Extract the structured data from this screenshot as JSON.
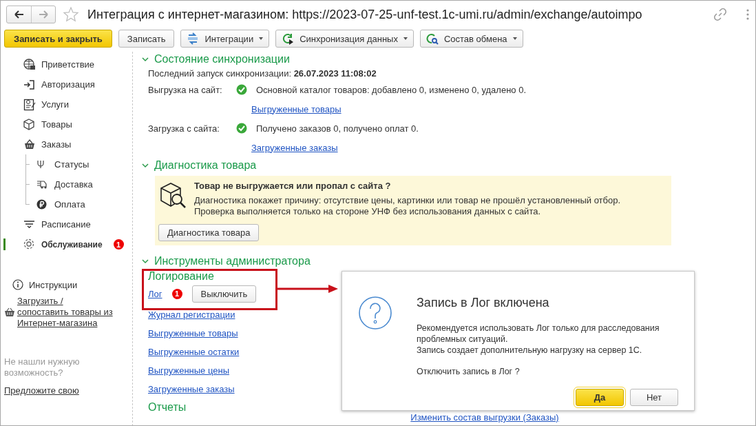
{
  "window": {
    "title": "Интеграция с интернет-магазином: https://2023-07-25-unf-test.1c-umi.ru/admin/exchange/autoimpo"
  },
  "toolbar": [
    {
      "label": "Записать и закрыть",
      "kind": "primary"
    },
    {
      "label": "Записать",
      "kind": "plain"
    },
    {
      "label": "Интеграции",
      "kind": "menu"
    },
    {
      "label": "Синхронизация данных",
      "kind": "menu"
    },
    {
      "label": "Состав обмена",
      "kind": "menu"
    }
  ],
  "sidebar": {
    "items": [
      {
        "label": "Приветствие",
        "selected": false
      },
      {
        "label": "Авторизация",
        "selected": false
      },
      {
        "label": "Услуги",
        "selected": false
      },
      {
        "label": "Товары",
        "selected": false
      },
      {
        "label": "Заказы",
        "selected": false,
        "children": [
          {
            "label": "Статусы",
            "selected": false
          },
          {
            "label": "Доставка",
            "selected": false
          },
          {
            "label": "Оплата",
            "selected": false
          }
        ]
      },
      {
        "label": "Расписание",
        "selected": false
      },
      {
        "label": "Обслуживание",
        "selected": true,
        "badge": "1"
      }
    ],
    "instructions": "Инструкции",
    "import_link": "Загрузить / сопоставить товары из Интернет-магазина",
    "hint": "Не нашли нужную возможность?",
    "suggest_link": "Предложите свою"
  },
  "sections": [
    {
      "kind": "sync",
      "title": "Состояние синхронизации",
      "expanded": true,
      "last_run": "Последний запуск синхронизации: **26.07.2023 11:08:02**",
      "rows": [
        {
          "label": "Выгрузка на сайт:",
          "ok": true,
          "text": "Основной каталог товаров: добавлено 0, изменено 0, удалено 0.",
          "link": "Выгруженные товары"
        },
        {
          "label": "Загрузка с сайта:",
          "ok": true,
          "text": "Получено заказов 0, получено оплат 0.",
          "link": "Загруженные заказы"
        }
      ]
    },
    {
      "kind": "diagnostics",
      "title": "Диагностика товара",
      "expanded": true,
      "notice": {
        "heading": "Товар не выгружается или пропал с сайта ?",
        "lines": [
          "Диагностика покажет причину: отсутствие цены, картинки или товар не прошёл установленный отбор.",
          "Проверка выполняется только на стороне УНФ без использования данных с сайта."
        ]
      },
      "button": "Диагностика товара"
    },
    {
      "kind": "admin",
      "title": "Инструменты администратора",
      "expanded": true,
      "logging": {
        "title": "Логирование",
        "link": "Лог",
        "badge": "1",
        "button": "Выключить"
      },
      "links": [
        "Журнал регистрации",
        "Выгруженные товары",
        "Выгруженные остатки",
        "Выгруженные цены",
        "Загруженные заказы"
      ],
      "reports": {
        "title": "Отчеты",
        "link": "Изменить состав выгрузки (Заказы)"
      }
    }
  ],
  "dialog": {
    "title": "Запись в Лог включена",
    "message": [
      "Рекомендуется использовать Лог только для расследования проблемных ситуаций.",
      "Запись создает дополнительную нагрузку на сервер 1С."
    ],
    "question": "Отключить запись в Лог ?",
    "buttons": [
      {
        "label": "Да",
        "default": true
      },
      {
        "label": "Нет",
        "default": false
      }
    ]
  }
}
